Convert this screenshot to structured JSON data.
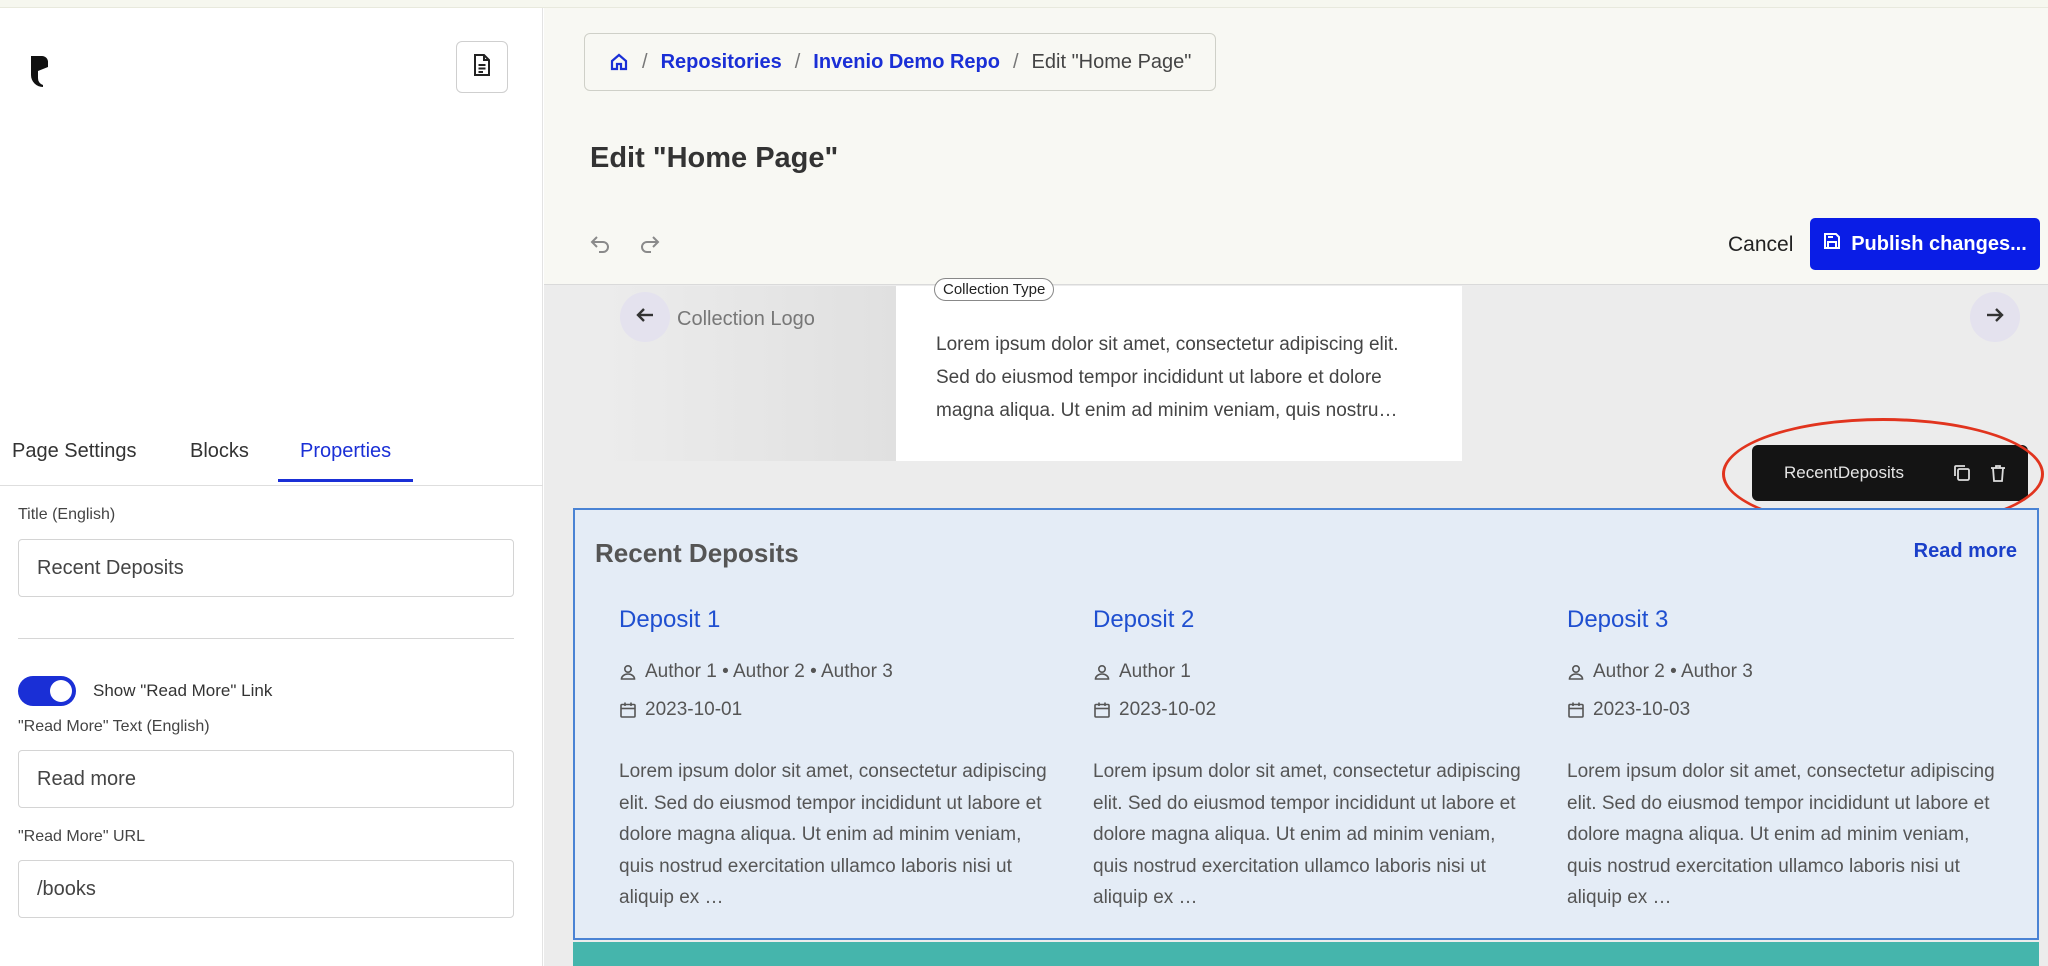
{
  "sidebar": {
    "tabs": [
      {
        "label": "Page Settings"
      },
      {
        "label": "Blocks"
      },
      {
        "label": "Properties"
      }
    ],
    "fields": {
      "title_label": "Title (English)",
      "title_value": "Recent Deposits",
      "show_read_more_label": "Show \"Read More\" Link",
      "show_read_more_on": true,
      "read_more_text_label": "\"Read More\" Text (English)",
      "read_more_text_value": "Read more",
      "read_more_url_label": "\"Read More\" URL",
      "read_more_url_value": "/books"
    }
  },
  "header": {
    "breadcrumb": [
      {
        "label": "Repositories"
      },
      {
        "label": "Invenio Demo Repo"
      },
      {
        "label": "Edit \"Home Page\""
      }
    ],
    "page_title": "Edit \"Home Page\"",
    "cancel_label": "Cancel",
    "publish_label": "Publish changes..."
  },
  "carousel": {
    "logo_text": "Collection Logo",
    "collection_type": "Collection Type",
    "text": "Lorem ipsum dolor sit amet, consectetur adipiscing elit. Sed do eiusmod tempor incididunt ut labore et dolore magna aliqua. Ut enim ad minim veniam, quis nostru…"
  },
  "block_toolbar": {
    "label": "RecentDeposits"
  },
  "recent_deposits": {
    "title": "Recent Deposits",
    "read_more": "Read more",
    "items": [
      {
        "title": "Deposit 1",
        "authors": "Author 1 • Author 2 • Author 3",
        "date": "2023-10-01",
        "description": "Lorem ipsum dolor sit amet, consectetur adipiscing elit. Sed do eiusmod tempor incididunt ut labore et dolore magna aliqua. Ut enim ad minim veniam, quis nostrud exercitation ullamco laboris nisi ut aliquip ex …"
      },
      {
        "title": "Deposit 2",
        "authors": "Author 1",
        "date": "2023-10-02",
        "description": "Lorem ipsum dolor sit amet, consectetur adipiscing elit. Sed do eiusmod tempor incididunt ut labore et dolore magna aliqua. Ut enim ad minim veniam, quis nostrud exercitation ullamco laboris nisi ut aliquip ex …"
      },
      {
        "title": "Deposit 3",
        "authors": "Author 2 • Author 3",
        "date": "2023-10-03",
        "description": "Lorem ipsum dolor sit amet, consectetur adipiscing elit. Sed do eiusmod tempor incididunt ut labore et dolore magna aliqua. Ut enim ad minim veniam, quis nostrud exercitation ullamco laboris nisi ut aliquip ex …"
      }
    ]
  },
  "colors": {
    "accent": "#1a2fd6",
    "publish_bg": "#0a1de6",
    "highlight_ellipse": "#e1341e",
    "block_border": "#4a83d4",
    "teal_bar": "#45b5ac"
  }
}
